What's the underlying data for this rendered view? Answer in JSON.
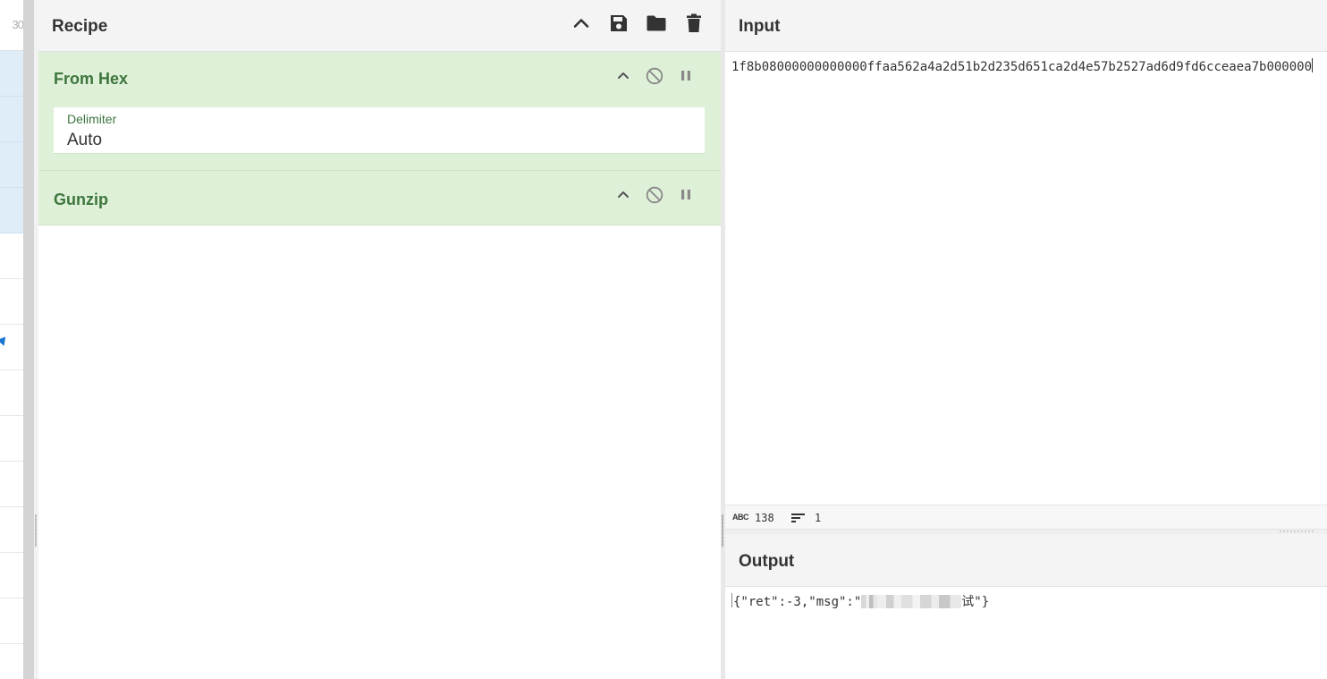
{
  "ops_strip": {
    "partial_number": "30"
  },
  "recipe": {
    "title": "Recipe",
    "header_icons": [
      "chevron-up-icon",
      "save-icon",
      "folder-icon",
      "trash-icon"
    ],
    "operations": [
      {
        "name": "From Hex",
        "args": [
          {
            "label": "Delimiter",
            "value": "Auto"
          }
        ]
      },
      {
        "name": "Gunzip",
        "args": []
      }
    ]
  },
  "input": {
    "title": "Input",
    "text": "1f8b08000000000000ffaa562a4a2d51b2d235d651ca2d4e57b2527ad6d9fd6cceaea7b000000",
    "status": {
      "abc_label": "ABC",
      "length": "138",
      "lines": "1"
    }
  },
  "output": {
    "title": "Output",
    "text_prefix": "{\"ret\":-3,\"msg\":\"",
    "text_suffix": "试\"}"
  },
  "colors": {
    "operation_bg": "#dff0d8",
    "operation_text": "#3c763d",
    "header_bg": "#f4f4f4",
    "selected_row_bg": "#dfedf9"
  }
}
